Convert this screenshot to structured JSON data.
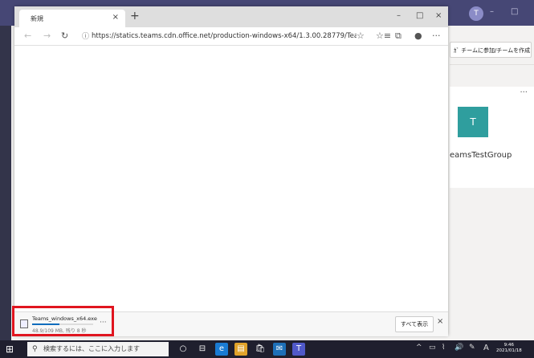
{
  "teams": {
    "avatar_initial": "T",
    "join_create_label": "ｶﾞ チームに参加/チームを作成",
    "card_more": "···",
    "tile_initial": "T",
    "team_name": "eamsTestGroup",
    "window_buttons": [
      "–",
      "□"
    ]
  },
  "browser": {
    "tab_title": "新規",
    "tab_close": "×",
    "new_tab": "+",
    "window_buttons": {
      "minimize": "–",
      "maximize": "□",
      "close": "×"
    },
    "nav": {
      "back": "←",
      "forward": "→",
      "refresh": "↻",
      "info": "ⓘ"
    },
    "url": "https://statics.teams.cdn.office.net/production-windows-x64/1.3.00.28779/Teams_wi...",
    "toolbar_icons": {
      "favorite": "☆",
      "favorites_list": "☆≡",
      "collections": "⧉",
      "profile": "●",
      "more": "···"
    }
  },
  "download": {
    "file_name": "Teams_windows_x64.exe",
    "status": "48.9/109 MB, 残り 8 秒",
    "progress": 0.45,
    "more": "···",
    "show_all": "すべて表示",
    "close": "×"
  },
  "taskbar": {
    "start_icon": "⊞",
    "search_icon": "⚲",
    "search_placeholder": "検索するには、ここに入力します",
    "apps": [
      "○",
      "⊟",
      "e",
      "▤",
      "🛍",
      "✉",
      "T"
    ],
    "tray": [
      "^",
      "▭",
      "⌇",
      "🔊",
      "✎",
      "A"
    ],
    "time": "9:46",
    "date": "2021/01/18"
  }
}
